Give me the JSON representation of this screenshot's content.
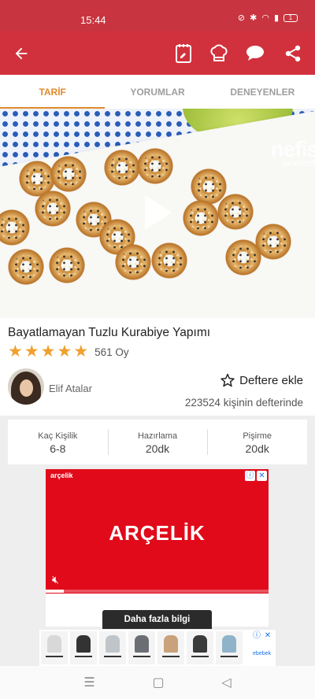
{
  "status": {
    "time": "15:44",
    "battery": "1"
  },
  "app_bar": {
    "icons": [
      "back-arrow-icon",
      "shopping-list-icon",
      "chef-hat-icon",
      "comment-icon",
      "share-icon"
    ]
  },
  "tabs": [
    {
      "label": "TARİF",
      "active": true
    },
    {
      "label": "YORUMLAR",
      "active": false
    },
    {
      "label": "DENEYENLER",
      "active": false
    }
  ],
  "hero": {
    "watermark": "nefis",
    "watermark_sub": "yemektarifle"
  },
  "recipe": {
    "title": "Bayatlamayan Tuzlu Kurabiye Yapımı",
    "rating": 5,
    "votes": "561 Oy",
    "author": "Elif Atalar",
    "favorite_label": "Deftere ekle",
    "favorite_count": "223524 kişinin defterinde"
  },
  "stats": [
    {
      "label": "Kaç Kişilik",
      "value": "6-8"
    },
    {
      "label": "Hazırlama",
      "value": "20dk"
    },
    {
      "label": "Pişirme",
      "value": "20dk"
    }
  ],
  "ad": {
    "small_logo": "arçelik",
    "brand": "ARÇELİK",
    "cta": "Daha fazla bilgi",
    "progress": 0.08
  },
  "banner": {
    "brand": "ebebek"
  },
  "colors": {
    "primary": "#d1313c",
    "accent": "#e08a2c",
    "star": "#f0a02e"
  }
}
